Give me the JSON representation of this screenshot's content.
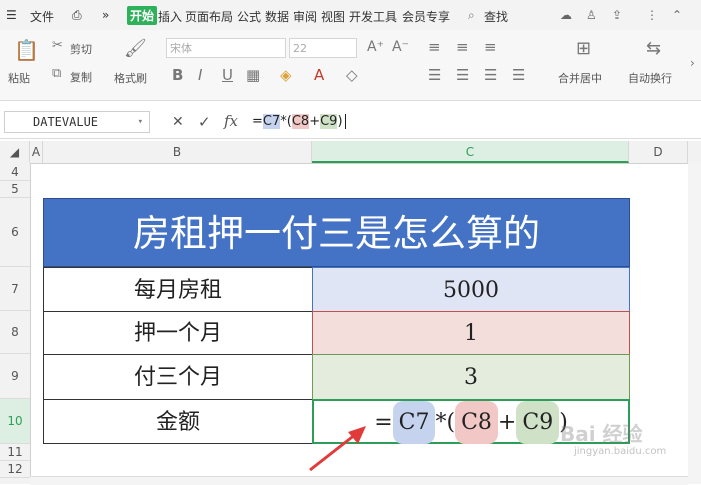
{
  "menu": {
    "file": "文件",
    "more": "»",
    "tabs": [
      "开始",
      "插入",
      "页面布局",
      "公式",
      "数据",
      "审阅",
      "视图",
      "开发工具",
      "会员专享"
    ],
    "search": "查找"
  },
  "ribbon": {
    "paste": "粘贴",
    "cut": "剪切",
    "copy": "复制",
    "format_painter": "格式刷",
    "font_name": "宋体",
    "font_size": "22",
    "bold": "B",
    "italic": "I",
    "underline": "U",
    "merge_center": "合并居中",
    "wrap_text": "自动换行"
  },
  "formula_bar": {
    "name_box": "DATEVALUE",
    "cancel": "✕",
    "confirm": "✓",
    "fx": "fx",
    "formula_prefix": "=",
    "ref1": "C7",
    "op1": "*(",
    "ref2": "C8",
    "op2": "+",
    "ref3": "C9",
    "op3": ")"
  },
  "columns": [
    "A",
    "B",
    "C",
    "D"
  ],
  "rows": [
    "4",
    "5",
    "6",
    "7",
    "8",
    "9",
    "10",
    "11",
    "12"
  ],
  "table": {
    "title": "房租押一付三是怎么算的",
    "rows": [
      {
        "label": "每月房租",
        "value": "5000"
      },
      {
        "label": "押一个月",
        "value": "1"
      },
      {
        "label": "付三个月",
        "value": "3"
      }
    ],
    "total_label": "金额",
    "total_formula": {
      "eq": "=",
      "ref1": "C7",
      "op1": "*(",
      "ref2": "C8",
      "op2": "+",
      "ref3": "C9",
      "op3": ")"
    }
  },
  "colors": {
    "accent": "#2fb05a",
    "title_bg": "#4472c4",
    "c7_bg": "#dfe5f5",
    "c8_bg": "#f4dedc",
    "c9_bg": "#e3ecdd",
    "active_border": "#2e9d5a",
    "arrow": "#e03a3a"
  },
  "watermark": "Bai 经验 jingyan.baidu.com"
}
